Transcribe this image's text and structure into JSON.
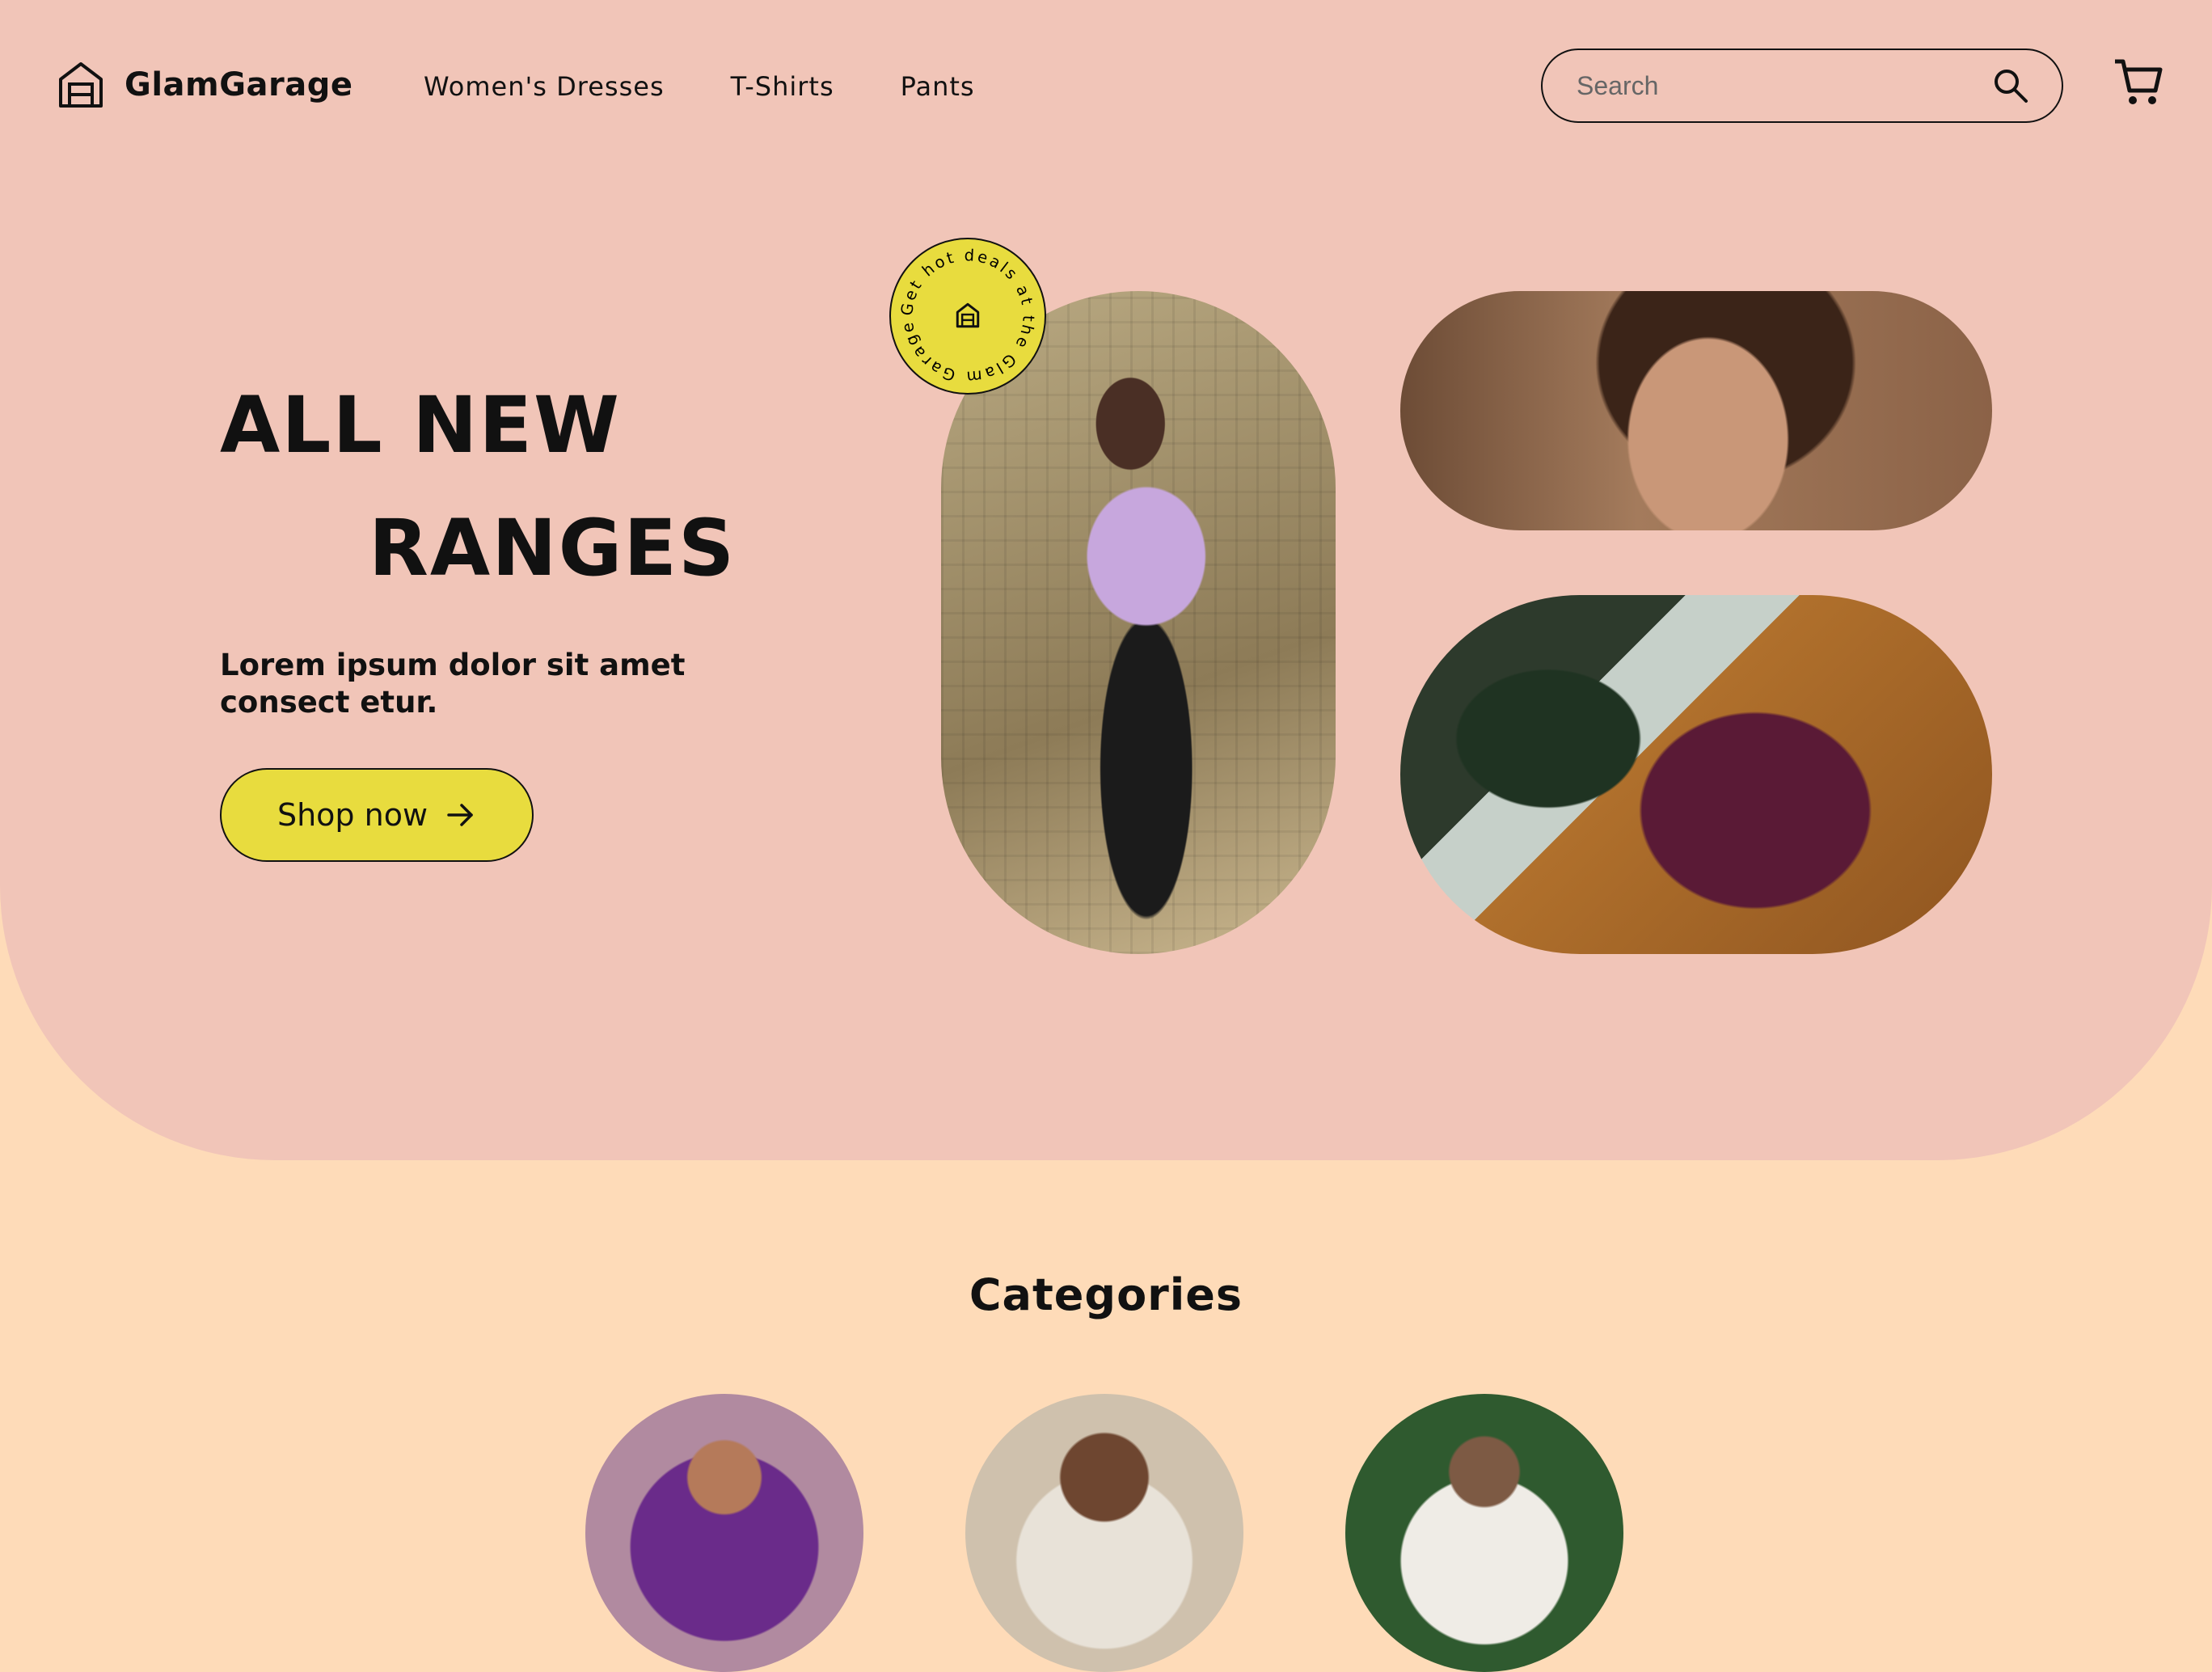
{
  "header": {
    "brand": "GlamGarage",
    "nav": [
      "Women's Dresses",
      "T-Shirts",
      "Pants"
    ],
    "search_placeholder": "Search"
  },
  "hero": {
    "line1": "ALL NEW",
    "line2": "RANGES",
    "subtitle": "Lorem ipsum dolor sit amet consect etur.",
    "cta_label": "Shop now",
    "badge_text": "Get hot deals at the Glam Garage"
  },
  "categories": {
    "title": "Categories"
  },
  "colors": {
    "hero_bg": "#f1c5b8",
    "page_bg": "#fedbb8",
    "accent": "#e8dc3e",
    "text": "#111111"
  },
  "icons": [
    "garage-logo-icon",
    "search-icon",
    "cart-icon",
    "arrow-right-icon"
  ]
}
